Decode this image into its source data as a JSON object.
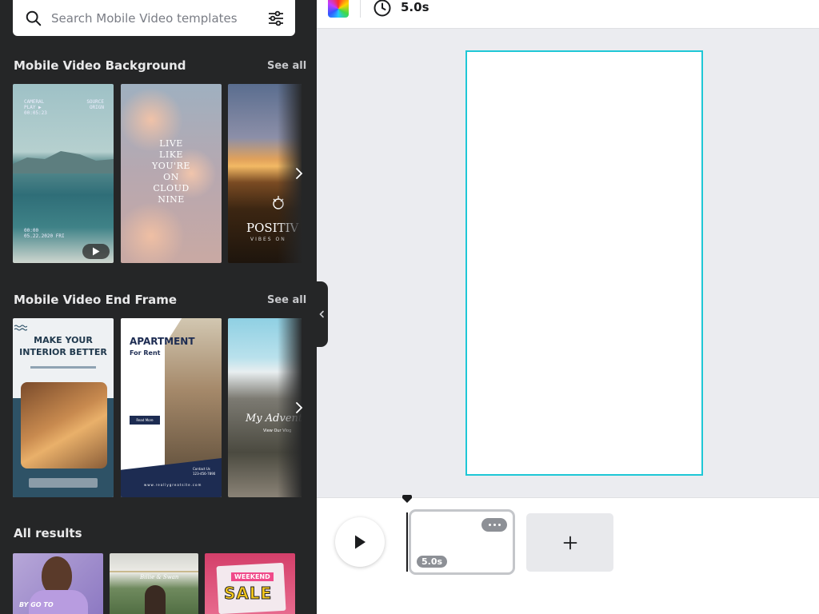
{
  "search": {
    "placeholder": "Search Mobile Video templates"
  },
  "sections": [
    {
      "title": "Mobile Video Background",
      "see_all": "See all",
      "thumbs": [
        {
          "top_left": "CAMERAL\nPLAY ▶\n00:05:23",
          "top_right": "SOURCE\nORIGN",
          "bottom": "00:00\n05.22.2020 FRI"
        },
        {
          "text": "LIVE\nLIKE\nYOU'RE\nON\nCLOUD\nNINE"
        },
        {
          "text": "POSITIV",
          "sub": "VIBES ON"
        }
      ]
    },
    {
      "title": "Mobile Video End Frame",
      "see_all": "See all",
      "thumbs": [
        {
          "title": "MAKE YOUR\nINTERIOR BETTER"
        },
        {
          "title": "APARTMENT",
          "sub": "For Rent",
          "contact": "Contact Us\n123-456-7890",
          "btn": "Read More",
          "url": "www.reallygreatsite.com"
        },
        {
          "text": "My Adventur",
          "sub": "View Our Vlog"
        }
      ]
    },
    {
      "title": "All results",
      "thumbs": [
        {
          "text": "BY GO TO"
        },
        {
          "text": "Billie & Swan"
        },
        {
          "text": "WEEKEND",
          "big": "SALE"
        }
      ]
    }
  ],
  "topbar": {
    "duration": "5.0s"
  },
  "timeline": {
    "clip_duration": "5.0s",
    "add_label": "+"
  },
  "colors": {
    "accent": "#1ec7d6",
    "panel_bg": "#252627",
    "canvas_bg": "#ebecf0"
  }
}
